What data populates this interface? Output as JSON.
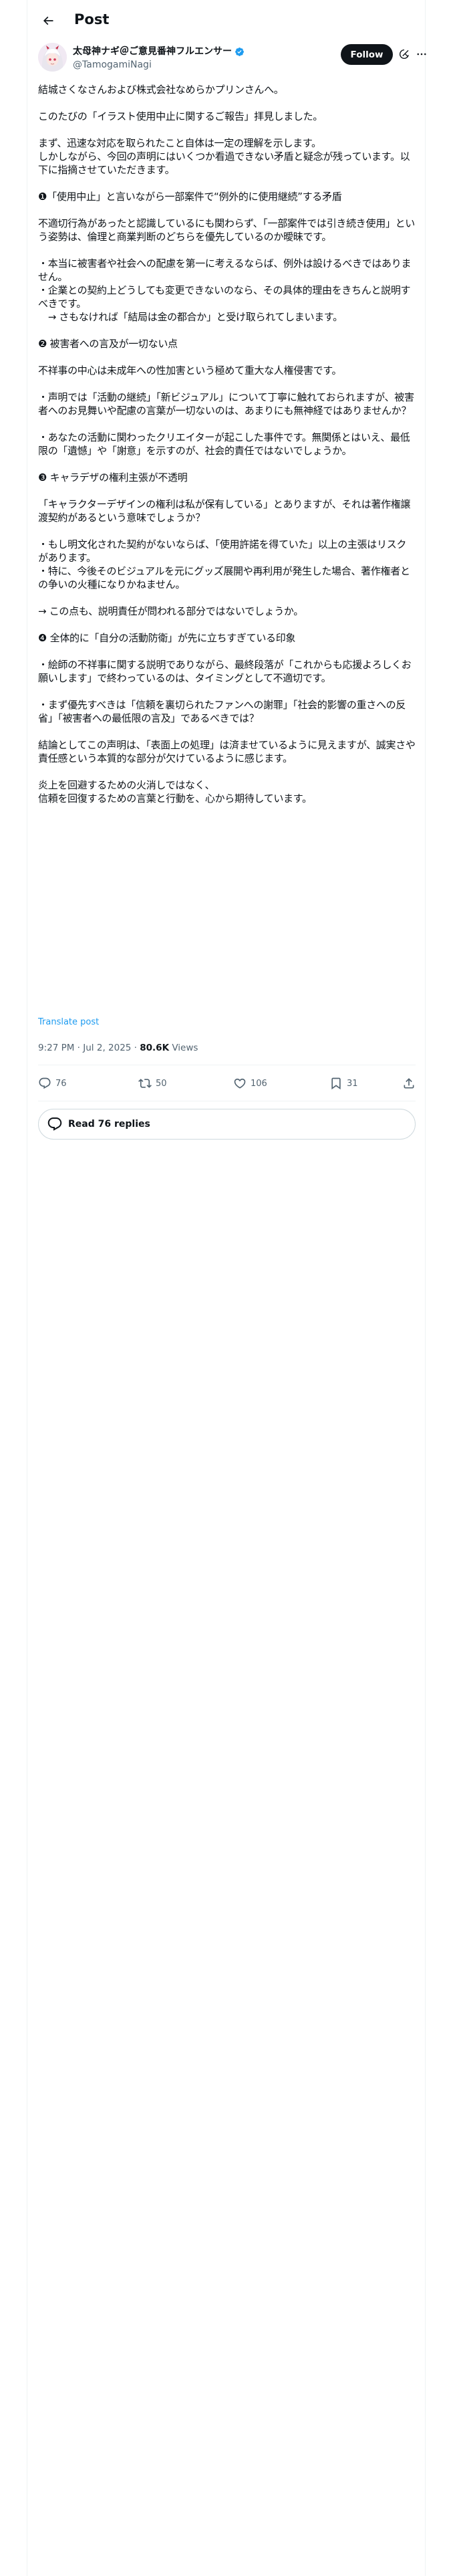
{
  "header": {
    "title": "Post"
  },
  "author": {
    "display_name": "太母神ナギ＠ご意見番神フルエンサー",
    "handle": "@TamogamiNagi",
    "follow_label": "Follow"
  },
  "post": {
    "text": "結城さくなさんおよび株式会社なめらかプリンさんへ。\n\nこのたびの「イラスト使用中止に関するご報告」拝見しました。\n\nまず、迅速な対応を取られたこと自体は一定の理解を示します。\nしかしながら、今回の声明にはいくつか看過できない矛盾と疑念が残っています。以下に指摘させていただきます。\n\n❶「使用中止」と言いながら一部案件で“例外的に使用継続”する矛盾\n\n不適切行為があったと認識しているにも関わらず、「一部案件では引き続き使用」という姿勢は、倫理と商業判断のどちらを優先しているのか曖昧です。\n\n・本当に被害者や社会への配慮を第一に考えるならば、例外は設けるべきではありません。\n・企業との契約上どうしても変更できないのなら、その具体的理由をきちんと説明すべきです。\n　→ さもなければ「結局は金の都合か」と受け取られてしまいます。\n\n❷ 被害者への言及が一切ない点\n\n不祥事の中心は未成年への性加害という極めて重大な人権侵害です。\n\n・声明では「活動の継続」「新ビジュアル」について丁寧に触れておられますが、被害者へのお見舞いや配慮の言葉が一切ないのは、あまりにも無神経ではありませんか？\n\n・あなたの活動に関わったクリエイターが起こした事件です。無関係とはいえ、最低限の「遺憾」や「謝意」を示すのが、社会的責任ではないでしょうか。\n\n❸ キャラデザの権利主張が不透明\n\n「キャラクターデザインの権利は私が保有している」とありますが、それは著作権譲渡契約があるという意味でしょうか？\n\n・もし明文化された契約がないならば、「使用許諾を得ていた」以上の主張はリスクがあります。\n・特に、今後そのビジュアルを元にグッズ展開や再利用が発生した場合、著作権者との争いの火種になりかねません。\n\n→ この点も、説明責任が問われる部分ではないでしょうか。\n\n❹ 全体的に「自分の活動防衛」が先に立ちすぎている印象\n\n・絵師の不祥事に関する説明でありながら、最終段落が「これからも応援よろしくお願いします」で終わっているのは、タイミングとして不適切です。\n\n・まず優先すべきは「信頼を裏切られたファンへの謝罪」「社会的影響の重さへの反省」「被害者への最低限の言及」であるべきでは？\n\n結論としてこの声明は、「表面上の処理」は済ませているように見えますが、誠実さや責任感という本質的な部分が欠けているように感じます。\n\n炎上を回避するための火消しではなく、\n信頼を回復するための言葉と行動を、心から期待しています。",
    "translate_label": "Translate post",
    "time": "9:27 PM · Jul 2, 2025",
    "views_count": "80.6K",
    "views_label": "Views"
  },
  "actions": {
    "replies": "76",
    "reposts": "50",
    "likes": "106",
    "bookmarks": "31"
  },
  "read_replies": {
    "label": "Read 76 replies"
  },
  "colors": {
    "text": "#0f1419",
    "secondary": "#536471",
    "link": "#1d9bf0",
    "border": "#eff3f4",
    "button": "#0f1419"
  }
}
